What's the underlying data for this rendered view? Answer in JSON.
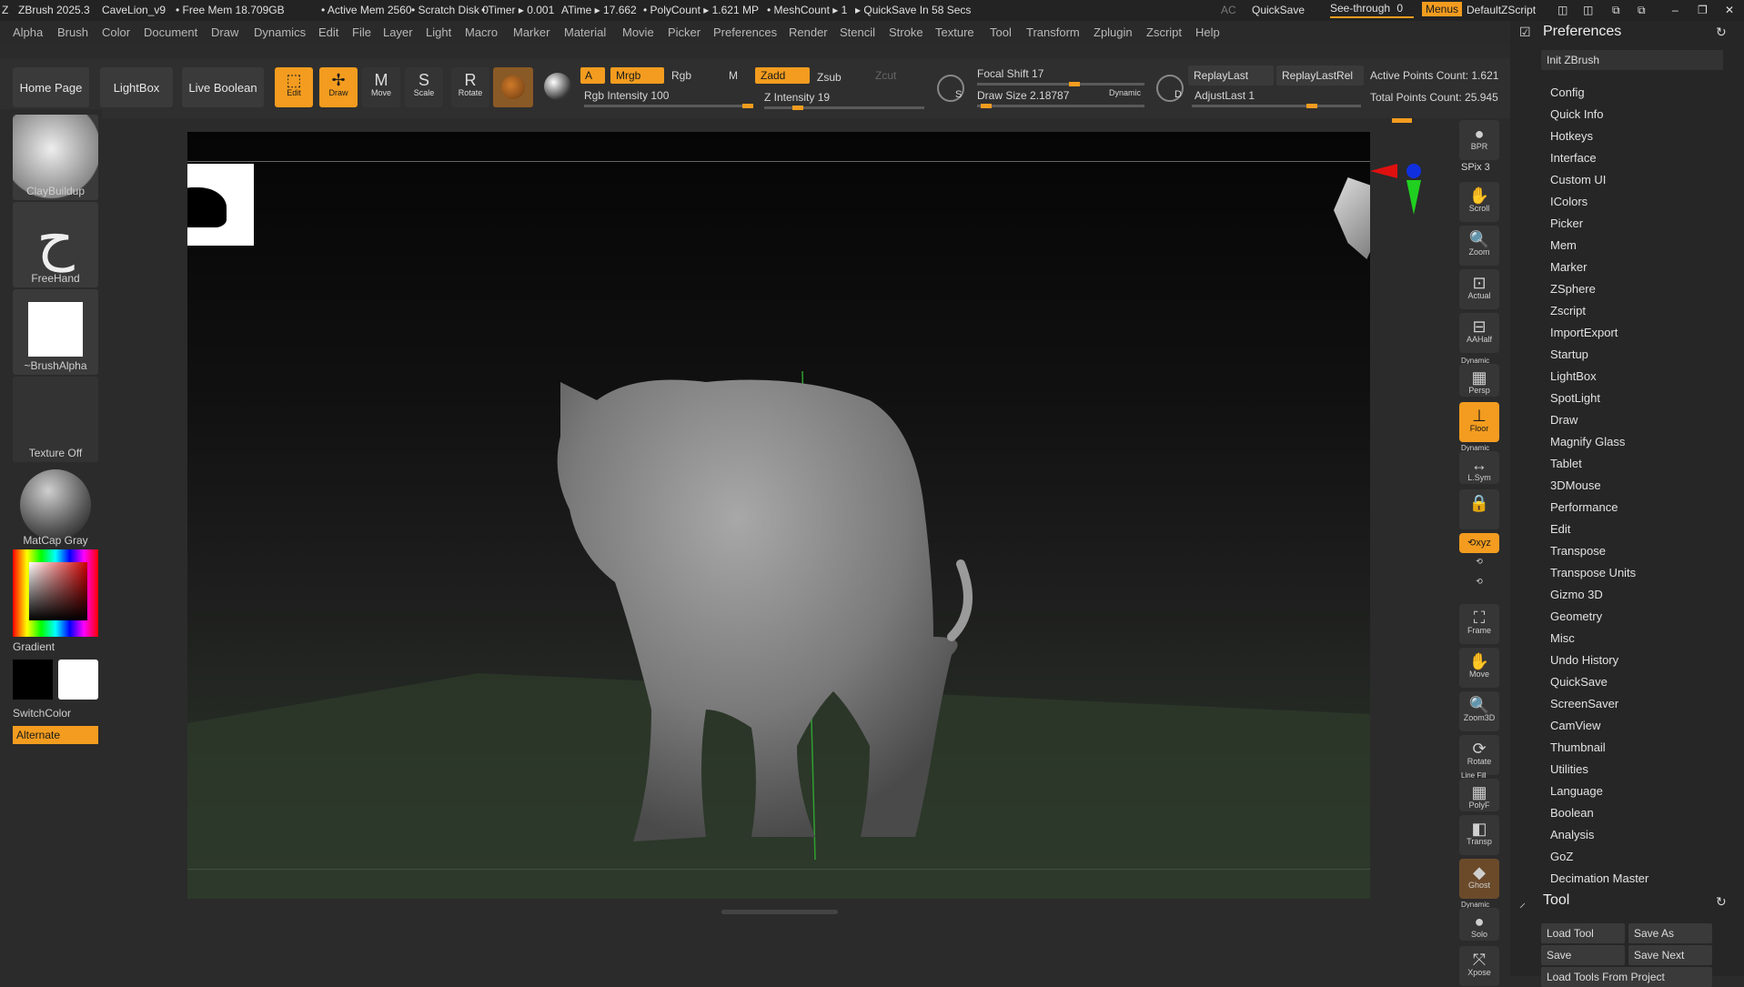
{
  "titlebar": {
    "app": "ZBrush 2025.3",
    "document": "CaveLion_v9",
    "free_mem": "• Free Mem 18.709GB",
    "active_mem": "• Active Mem 2560",
    "scratch_disk": "• Scratch Disk 0",
    "timer": "• Timer ▸ 0.001",
    "atime": "ATime ▸ 17.662",
    "polycount": "• PolyCount ▸ 1.621 MP",
    "meshcount": "• MeshCount ▸ 1",
    "quicksave": "▸ QuickSave In 58 Secs",
    "ac": "AC",
    "quicksave_btn": "QuickSave",
    "see_through_label": "See-through",
    "see_through_value": "0",
    "menus_btn": "Menus",
    "script": "DefaultZScript"
  },
  "menubar": [
    "Alpha",
    "Brush",
    "Color",
    "Document",
    "Draw",
    "Dynamics",
    "Edit",
    "File",
    "Layer",
    "Light",
    "Macro",
    "Marker",
    "Material",
    "Movie",
    "Picker",
    "Preferences",
    "Render",
    "Stencil",
    "Stroke",
    "Texture",
    "Tool",
    "Transform",
    "Zplugin",
    "Zscript",
    "Help"
  ],
  "toolbar": {
    "home_page": "Home Page",
    "lightbox": "LightBox",
    "live_boolean": "Live Boolean",
    "edit": "Edit",
    "draw": "Draw",
    "move": "Move",
    "scale": "Scale",
    "rotate": "Rotate",
    "a": "A",
    "mrgb": "Mrgb",
    "rgb": "Rgb",
    "m": "M",
    "zadd": "Zadd",
    "zsub": "Zsub",
    "zcut": "Zcut",
    "rgb_intensity": "Rgb Intensity 100",
    "rgb_intensity_value": 100,
    "z_intensity": "Z Intensity 19",
    "z_intensity_value": 19,
    "focal_shift": "Focal Shift 17",
    "focal_shift_value": 17,
    "draw_size": "Draw Size 2.18787",
    "draw_size_value": 2.18787,
    "dynamic": "Dynamic",
    "s": "S",
    "d": "D",
    "replay_last": "ReplayLast",
    "replay_last_rel": "ReplayLastRel",
    "adjust_last": "AdjustLast 1",
    "adjust_last_value": 1,
    "active_points": "Active Points Count: 1.621",
    "total_points": "Total Points Count: 25.945"
  },
  "leftpanel": {
    "brush1": "ClayBuildup",
    "stroke": "FreeHand",
    "alpha": "~BrushAlpha",
    "texture": "Texture Off",
    "material": "MatCap Gray",
    "gradient": "Gradient",
    "switchcolor": "SwitchColor",
    "alternate": "Alternate"
  },
  "rightshelf": {
    "bpr": "BPR",
    "spix": "SPix 3",
    "scroll": "Scroll",
    "zoom": "Zoom",
    "actual": "Actual",
    "aahalf": "AAHalf",
    "dynamic1": "Dynamic",
    "persp": "Persp",
    "floor": "Floor",
    "dynamic2": "Dynamic",
    "lsym": "L.Sym",
    "xyz": "⟲xyz",
    "frame": "Frame",
    "move": "Move",
    "zoom3d": "Zoom3D",
    "rotate": "Rotate",
    "linefill": "Line Fill",
    "polyf": "PolyF",
    "transp": "Transp",
    "ghost": "Ghost",
    "dynamic3": "Dynamic",
    "solo": "Solo",
    "xpose": "Xpose"
  },
  "preferences": {
    "title": "Preferences",
    "init": "Init ZBrush",
    "items": [
      "Config",
      "Quick Info",
      "Hotkeys",
      "Interface",
      "Custom UI",
      "IColors",
      "Picker",
      "Mem",
      "Marker",
      "ZSphere",
      "Zscript",
      "ImportExport",
      "Startup",
      "LightBox",
      "SpotLight",
      "Draw",
      "Magnify Glass",
      "Tablet",
      "3DMouse",
      "Performance",
      "Edit",
      "Transpose",
      "Transpose Units",
      "Gizmo 3D",
      "Geometry",
      "Misc",
      "Undo History",
      "QuickSave",
      "ScreenSaver",
      "CamView",
      "Thumbnail",
      "Utilities",
      "Language",
      "Boolean",
      "Analysis",
      "GoZ",
      "Decimation Master"
    ]
  },
  "tool": {
    "title": "Tool",
    "load_tool": "Load Tool",
    "save_as": "Save As",
    "save": "Save",
    "save_next": "Save Next",
    "load_from_project": "Load Tools From Project"
  },
  "colors": {
    "accent": "#f39c1f",
    "background": "#2b2b2b",
    "panel": "#262626"
  }
}
